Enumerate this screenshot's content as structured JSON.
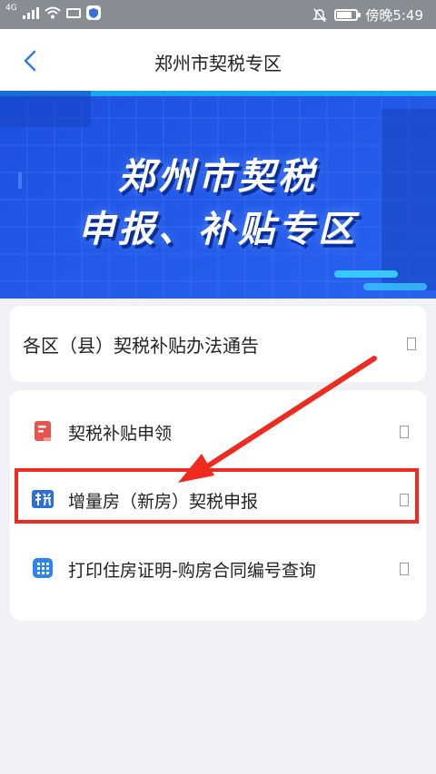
{
  "status_bar": {
    "network": "4G",
    "time": "傍晚5:49",
    "icons": [
      "signal-icon",
      "wifi-icon",
      "mail-icon",
      "shield-app-icon",
      "mute-icon",
      "battery-icon"
    ]
  },
  "nav": {
    "title": "郑州市契税专区",
    "back_icon": "chevron-left-icon"
  },
  "banner": {
    "line1": "郑州市契税",
    "line2": "申报、补贴专区"
  },
  "notice": {
    "label": "各区（县）契税补贴办法通告"
  },
  "services": [
    {
      "label": "契税补贴申领",
      "icon": "document-icon"
    },
    {
      "label": "增量房（新房）契税申报",
      "icon": "tax-logo-icon"
    },
    {
      "label": "打印住房证明-购房合同编号查询",
      "icon": "building-icon"
    }
  ],
  "annotation": {
    "color": "#ef2b20",
    "highlighted_item": "增量房（新房）契税申报"
  },
  "colors": {
    "accent": "#2f7be8",
    "banner_bg": "#1f56e6",
    "page_bg": "#f2f2f6"
  }
}
